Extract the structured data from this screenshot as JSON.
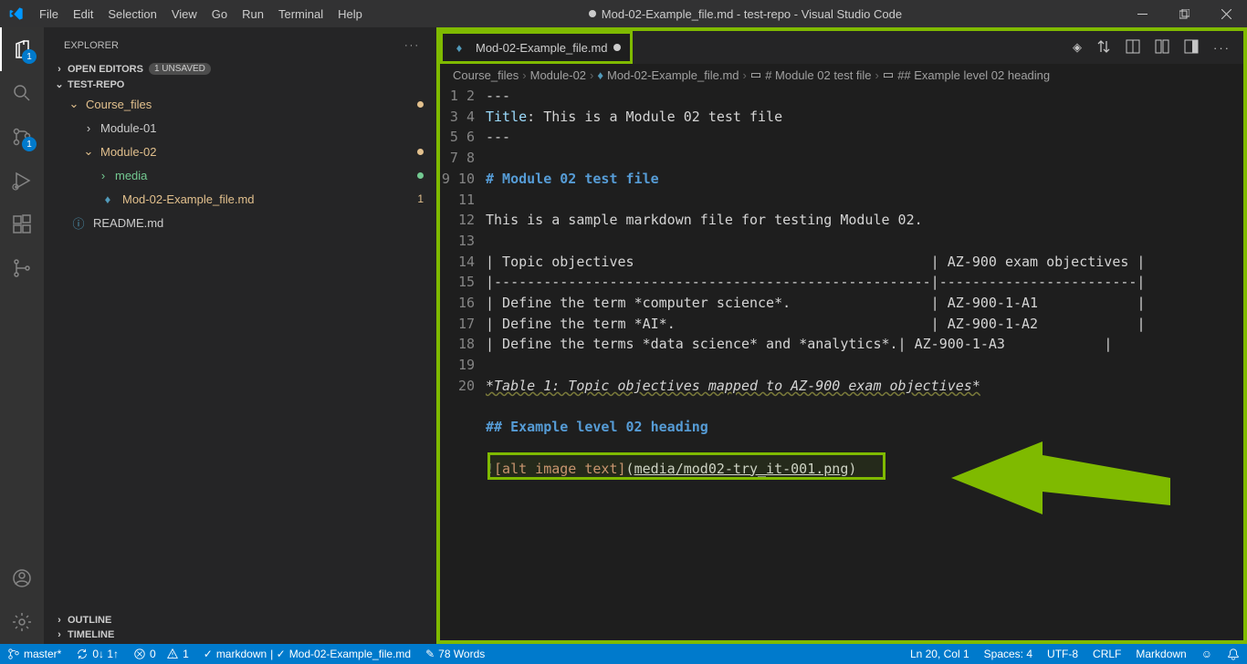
{
  "titlebar": {
    "menu": [
      "File",
      "Edit",
      "Selection",
      "View",
      "Go",
      "Run",
      "Terminal",
      "Help"
    ],
    "title_file": "Mod-02-Example_file.md",
    "title_rest": " - test-repo - Visual Studio Code"
  },
  "activity": {
    "explorer_badge": "1",
    "scm_badge": "1"
  },
  "explorer": {
    "title": "EXPLORER",
    "open_editors": "OPEN EDITORS",
    "unsaved": "1 UNSAVED",
    "repo": "TEST-REPO",
    "tree": {
      "course_files": "Course_files",
      "module01": "Module-01",
      "module02": "Module-02",
      "media": "media",
      "example_file": "Mod-02-Example_file.md",
      "readme": "README.md",
      "mod_count": "1"
    },
    "outline": "OUTLINE",
    "timeline": "TIMELINE"
  },
  "tab": {
    "label": "Mod-02-Example_file.md"
  },
  "breadcrumb": {
    "p1": "Course_files",
    "p2": "Module-02",
    "p3": "Mod-02-Example_file.md",
    "p4": "# Module 02 test file",
    "p5": "## Example level 02 heading"
  },
  "code": {
    "l1": "---",
    "l2_key": "Title",
    "l2_val": ": This is a Module 02 test file",
    "l3": "---",
    "l5": "# Module 02 test file",
    "l7": "This is a sample markdown file for testing Module 02.",
    "l9": "| Topic objectives                                    | AZ-900 exam objectives |",
    "l10": "|-----------------------------------------------------|------------------------|",
    "l11a": "| Define the term ",
    "l11b": "*computer science*",
    "l11c": ".                 | AZ-900-1-A1            |",
    "l12a": "| Define the term ",
    "l12b": "*AI*",
    "l12c": ".                               | AZ-900-1-A2            |",
    "l13a": "| Define the terms ",
    "l13b": "*data science*",
    "l13c": " and ",
    "l13d": "*analytics*",
    "l13e": ".| AZ-900-1-A3            |",
    "l15": "*Table 1: Topic objectives mapped to AZ-900 exam objectives*",
    "l17": "## Example level 02 heading",
    "l19_bang": "!",
    "l19_alt": "[alt image text]",
    "l19_open": "(",
    "l19_link": "media/mod02-try_it-001.png",
    "l19_close": ")"
  },
  "status": {
    "branch": "master*",
    "sync": "0↓ 1↑",
    "errors": "0",
    "warnings": "1",
    "lint": "markdown",
    "lint_file": "Mod-02-Example_file.md",
    "words": "78 Words",
    "pos": "Ln 20, Col 1",
    "spaces": "Spaces: 4",
    "encoding": "UTF-8",
    "eol": "CRLF",
    "lang": "Markdown"
  }
}
